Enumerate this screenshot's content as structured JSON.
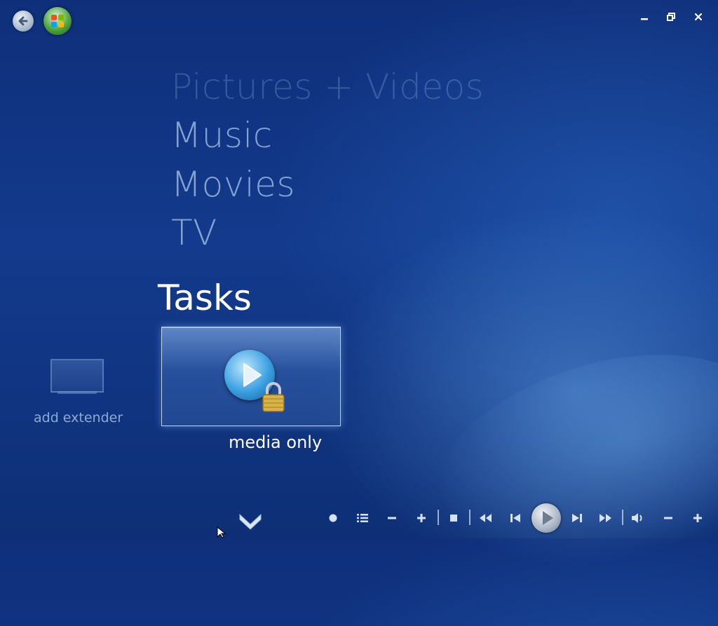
{
  "menu": {
    "items": [
      {
        "label": "Pictures + Videos"
      },
      {
        "label": "Music"
      },
      {
        "label": "Movies"
      },
      {
        "label": "TV"
      }
    ],
    "section_title": "Tasks"
  },
  "tiles": {
    "extender_label": "add extender",
    "selected_label": "media only"
  },
  "icons": {
    "back": "back-arrow-icon",
    "start": "windows-start-orb-icon",
    "minimize": "minimize-icon",
    "restore": "restore-icon",
    "close": "close-icon",
    "more": "chevron-down-icon",
    "record": "record-icon",
    "guide": "guide-list-icon",
    "channel_down": "minus-icon",
    "channel_up": "plus-icon",
    "stop": "stop-icon",
    "rewind": "rewind-icon",
    "previous": "skip-previous-icon",
    "play": "play-icon",
    "next": "skip-next-icon",
    "fast_forward": "fast-forward-icon",
    "mute": "speaker-icon",
    "volume_down": "minus-icon",
    "volume_up": "plus-icon"
  },
  "colors": {
    "background": "#133a8c",
    "accent": "#3a9fe0",
    "text": "#ffffff"
  }
}
